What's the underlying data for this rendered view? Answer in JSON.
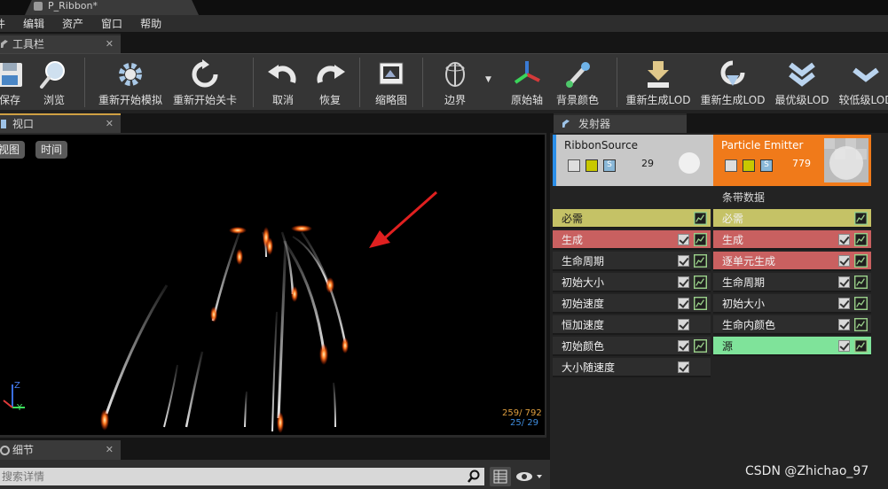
{
  "window": {
    "doc_tab": "P_Ribbon*"
  },
  "menu": [
    "件",
    "编辑",
    "资产",
    "窗口",
    "帮助"
  ],
  "toolbar_panel": {
    "tab": "工具栏",
    "close": "✕"
  },
  "toolbar": {
    "save": "保存",
    "browse": "浏览",
    "restart_sim": "重新开始模拟",
    "restart_level": "重新开始关卡",
    "undo": "取消",
    "redo": "恢复",
    "thumbnail": "缩略图",
    "bounds": "边界",
    "origin_axis": "原始轴",
    "bg_color": "背景颜色",
    "regen_lod1": "重新生成LOD",
    "regen_lod2": "重新生成LOD",
    "highest_lod": "最优级LOD",
    "lower_lod": "较低级LOD"
  },
  "viewport": {
    "tab": "视口",
    "close": "✕",
    "view_btn": "视图",
    "time_btn": "时间",
    "stats_line1": "259/ 792",
    "stats_line2": "25/  29",
    "axis_z": "Z",
    "axis_y": "Y"
  },
  "details": {
    "tab": "细节",
    "close": "✕",
    "search_placeholder": "搜索详情"
  },
  "emitters_panel": {
    "tab": "发射器",
    "emitters": [
      {
        "name": "RibbonSource",
        "count": "29",
        "header_color": "#c8c8c8",
        "text_color": "#1a1a1a",
        "type_label": "",
        "modules": [
          {
            "label": "必需",
            "color": "#c5c266",
            "dark_text": true,
            "has_check": false
          },
          {
            "label": "生成",
            "color": "#c96060",
            "dark_text": false,
            "has_check": true
          },
          {
            "label": "生命周期",
            "color": "#2d2d2d",
            "dark_text": false,
            "has_check": true
          },
          {
            "label": "初始大小",
            "color": "#2d2d2d",
            "dark_text": false,
            "has_check": true
          },
          {
            "label": "初始速度",
            "color": "#2d2d2d",
            "dark_text": false,
            "has_check": true
          },
          {
            "label": "恒加速度",
            "color": "#2d2d2d",
            "dark_text": false,
            "has_check": true,
            "no_curve": true
          },
          {
            "label": "初始颜色",
            "color": "#2d2d2d",
            "dark_text": false,
            "has_check": true
          },
          {
            "label": "大小随速度",
            "color": "#2d2d2d",
            "dark_text": false,
            "has_check": true,
            "no_curve": true
          }
        ]
      },
      {
        "name": "Particle Emitter",
        "count": "779",
        "header_color": "#f07a1a",
        "text_color": "#ffffff",
        "type_label": "条带数据",
        "modules": [
          {
            "label": "必需",
            "color": "#c5c266",
            "dark_text": false,
            "has_check": false
          },
          {
            "label": "生成",
            "color": "#c96060",
            "dark_text": false,
            "has_check": true
          },
          {
            "label": "逐单元生成",
            "color": "#c96060",
            "dark_text": false,
            "has_check": true
          },
          {
            "label": "生命周期",
            "color": "#2d2d2d",
            "dark_text": false,
            "has_check": true
          },
          {
            "label": "初始大小",
            "color": "#2d2d2d",
            "dark_text": false,
            "has_check": true
          },
          {
            "label": "生命内颜色",
            "color": "#2d2d2d",
            "dark_text": false,
            "has_check": true
          },
          {
            "label": "源",
            "color": "#7fe39a",
            "dark_text": true,
            "has_check": true
          }
        ]
      }
    ]
  },
  "watermark": "CSDN @Zhichao_97"
}
